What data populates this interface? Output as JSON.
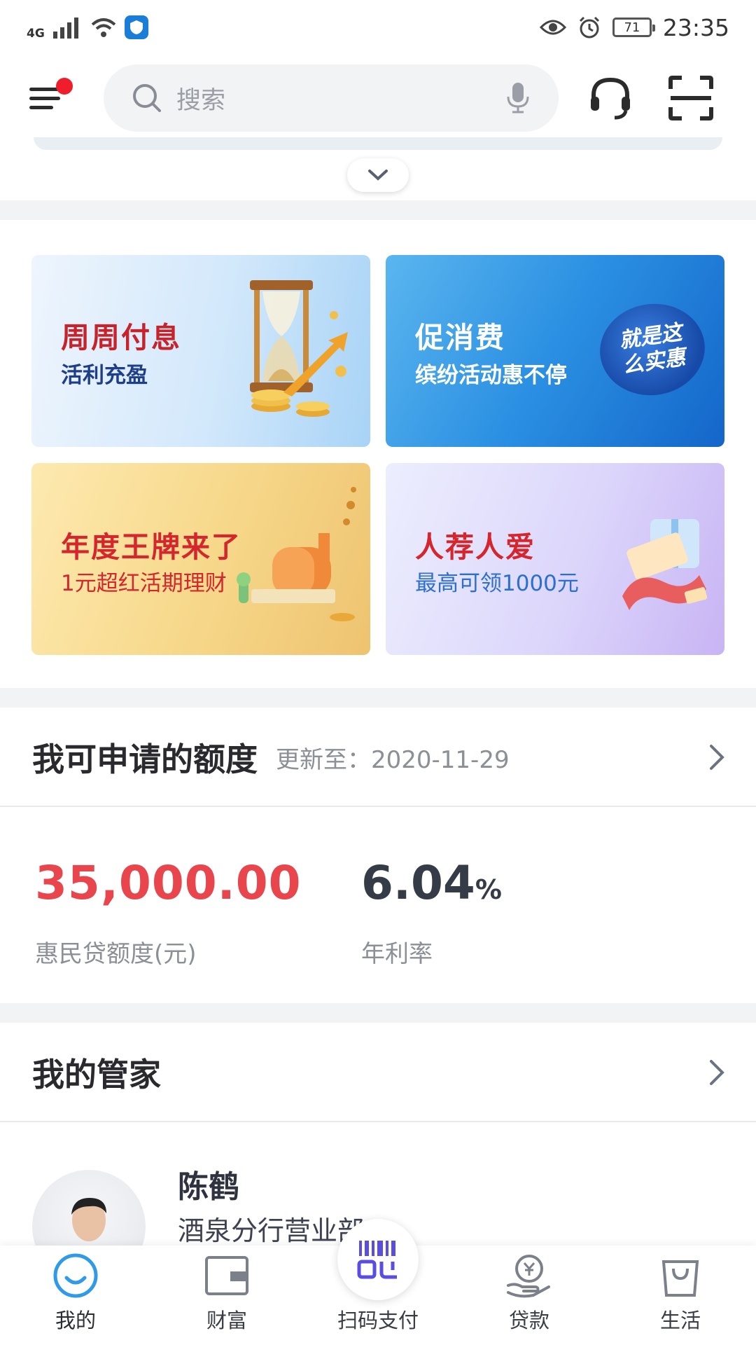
{
  "status_bar": {
    "network": "4G",
    "battery": "71",
    "time": "23:35",
    "icons": [
      "signal-icon",
      "wifi-icon",
      "shield-app-icon",
      "eye-care-icon",
      "alarm-icon",
      "battery-icon"
    ]
  },
  "header": {
    "search_placeholder": "搜索",
    "icons": [
      "menu-icon",
      "search-icon",
      "mic-icon",
      "headset-icon",
      "scan-icon"
    ]
  },
  "banners": [
    {
      "title": "周周付息",
      "subtitle": "活利充盈",
      "title_color": "#c8232b",
      "subtitle_color": "#1f3e8a"
    },
    {
      "title": "促消费",
      "subtitle": "缤纷活动惠不停",
      "stamp": "就是这么实惠",
      "title_color": "#ffffff",
      "subtitle_color": "#ffffff"
    },
    {
      "title": "年度王牌来了",
      "subtitle": "1元超红活期理财",
      "title_color": "#d6262d",
      "subtitle_color": "#d6262d"
    },
    {
      "title": "人荐人爱",
      "subtitle": "最高可领1000元",
      "title_color": "#d6262d",
      "subtitle_color": "#2b6fd0"
    }
  ],
  "credit": {
    "title": "我可申请的额度",
    "updated": "更新至：2020-11-29",
    "amount": "35,000.00",
    "amount_label": "惠民贷额度(元)",
    "rate": "6.04",
    "rate_unit": "%",
    "rate_label": "年利率"
  },
  "manager": {
    "title": "我的管家",
    "name": "陈鹤",
    "branch": "酒泉分行营业部"
  },
  "bottom_nav": [
    {
      "label": "我的",
      "icon": "profile-icon",
      "active": true
    },
    {
      "label": "财富",
      "icon": "wallet-icon",
      "active": false
    },
    {
      "label": "扫码支付",
      "icon": "qr-pay-icon",
      "active": false
    },
    {
      "label": "贷款",
      "icon": "loan-icon",
      "active": false
    },
    {
      "label": "生活",
      "icon": "shopping-bag-icon",
      "active": false
    }
  ],
  "colors": {
    "accent_red": "#e8454d",
    "brand_blue": "#1a7ed8",
    "scan_purple": "#5a4ee0"
  }
}
